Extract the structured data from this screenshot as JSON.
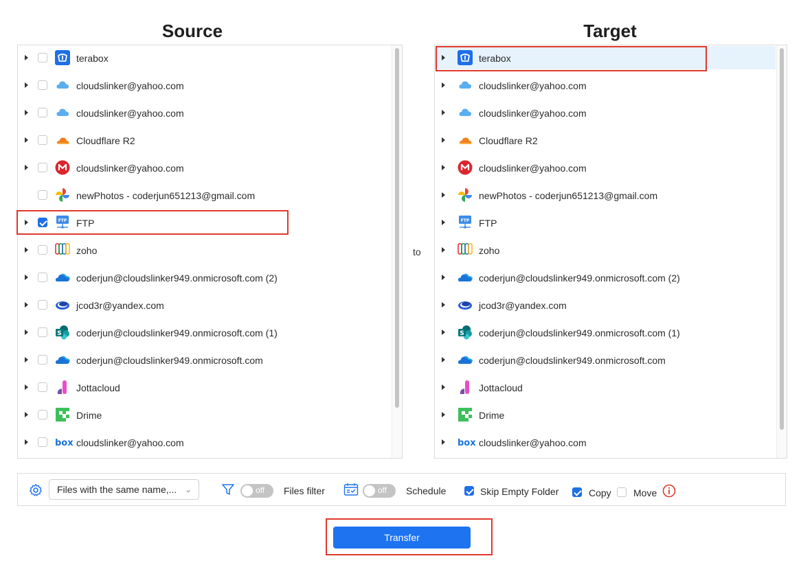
{
  "source": {
    "title": "Source",
    "items": [
      {
        "label": "terabox",
        "icon": "terabox-icon",
        "checked": false,
        "has_caret": true
      },
      {
        "label": "cloudslinker@yahoo.com",
        "icon": "icloud-icon",
        "checked": false,
        "has_caret": true
      },
      {
        "label": "cloudslinker@yahoo.com",
        "icon": "icloud-icon",
        "checked": false,
        "has_caret": true
      },
      {
        "label": "Cloudflare R2",
        "icon": "cloudflare-icon",
        "checked": false,
        "has_caret": true
      },
      {
        "label": "cloudslinker@yahoo.com",
        "icon": "mega-icon",
        "checked": false,
        "has_caret": true
      },
      {
        "label": "newPhotos - coderjun651213@gmail.com",
        "icon": "google-photos-icon",
        "checked": false,
        "has_caret": false
      },
      {
        "label": "FTP",
        "icon": "ftp-icon",
        "checked": true,
        "has_caret": true
      },
      {
        "label": "zoho",
        "icon": "zoho-icon",
        "checked": false,
        "has_caret": true
      },
      {
        "label": "coderjun@cloudslinker949.onmicrosoft.com (2)",
        "icon": "onedrive-icon",
        "checked": false,
        "has_caret": true
      },
      {
        "label": "jcod3r@yandex.com",
        "icon": "yandex-disk-icon",
        "checked": false,
        "has_caret": true
      },
      {
        "label": "coderjun@cloudslinker949.onmicrosoft.com (1)",
        "icon": "sharepoint-icon",
        "checked": false,
        "has_caret": true
      },
      {
        "label": "coderjun@cloudslinker949.onmicrosoft.com",
        "icon": "onedrive-icon",
        "checked": false,
        "has_caret": true
      },
      {
        "label": "Jottacloud",
        "icon": "jottacloud-icon",
        "checked": false,
        "has_caret": true
      },
      {
        "label": "Drime",
        "icon": "drime-icon",
        "checked": false,
        "has_caret": true
      },
      {
        "label": "cloudslinker@yahoo.com",
        "icon": "box-icon",
        "checked": false,
        "has_caret": true
      }
    ]
  },
  "connector": "to",
  "target": {
    "title": "Target",
    "items": [
      {
        "label": "terabox",
        "icon": "terabox-icon",
        "selected": true
      },
      {
        "label": "cloudslinker@yahoo.com",
        "icon": "icloud-icon"
      },
      {
        "label": "cloudslinker@yahoo.com",
        "icon": "icloud-icon"
      },
      {
        "label": "Cloudflare R2",
        "icon": "cloudflare-icon"
      },
      {
        "label": "cloudslinker@yahoo.com",
        "icon": "mega-icon"
      },
      {
        "label": "newPhotos - coderjun651213@gmail.com",
        "icon": "google-photos-icon"
      },
      {
        "label": "FTP",
        "icon": "ftp-icon"
      },
      {
        "label": "zoho",
        "icon": "zoho-icon"
      },
      {
        "label": "coderjun@cloudslinker949.onmicrosoft.com (2)",
        "icon": "onedrive-icon"
      },
      {
        "label": "jcod3r@yandex.com",
        "icon": "yandex-disk-icon"
      },
      {
        "label": "coderjun@cloudslinker949.onmicrosoft.com (1)",
        "icon": "sharepoint-icon"
      },
      {
        "label": "coderjun@cloudslinker949.onmicrosoft.com",
        "icon": "onedrive-icon"
      },
      {
        "label": "Jottacloud",
        "icon": "jottacloud-icon"
      },
      {
        "label": "Drime",
        "icon": "drime-icon"
      },
      {
        "label": "cloudslinker@yahoo.com",
        "icon": "box-icon"
      }
    ]
  },
  "options": {
    "conflict_select": "Files with the same name,...",
    "files_filter_toggle": "off",
    "files_filter_label": "Files filter",
    "schedule_toggle": "off",
    "schedule_label": "Schedule",
    "skip_empty_folder_label": "Skip Empty Folder",
    "skip_empty_folder_checked": true,
    "copy_label": "Copy",
    "copy_checked": true,
    "move_label": "Move",
    "move_checked": false
  },
  "transfer_button": "Transfer",
  "colors": {
    "accent": "#1e73f0",
    "highlight_border": "#e0382b",
    "selected_row": "#e6f2fc"
  }
}
